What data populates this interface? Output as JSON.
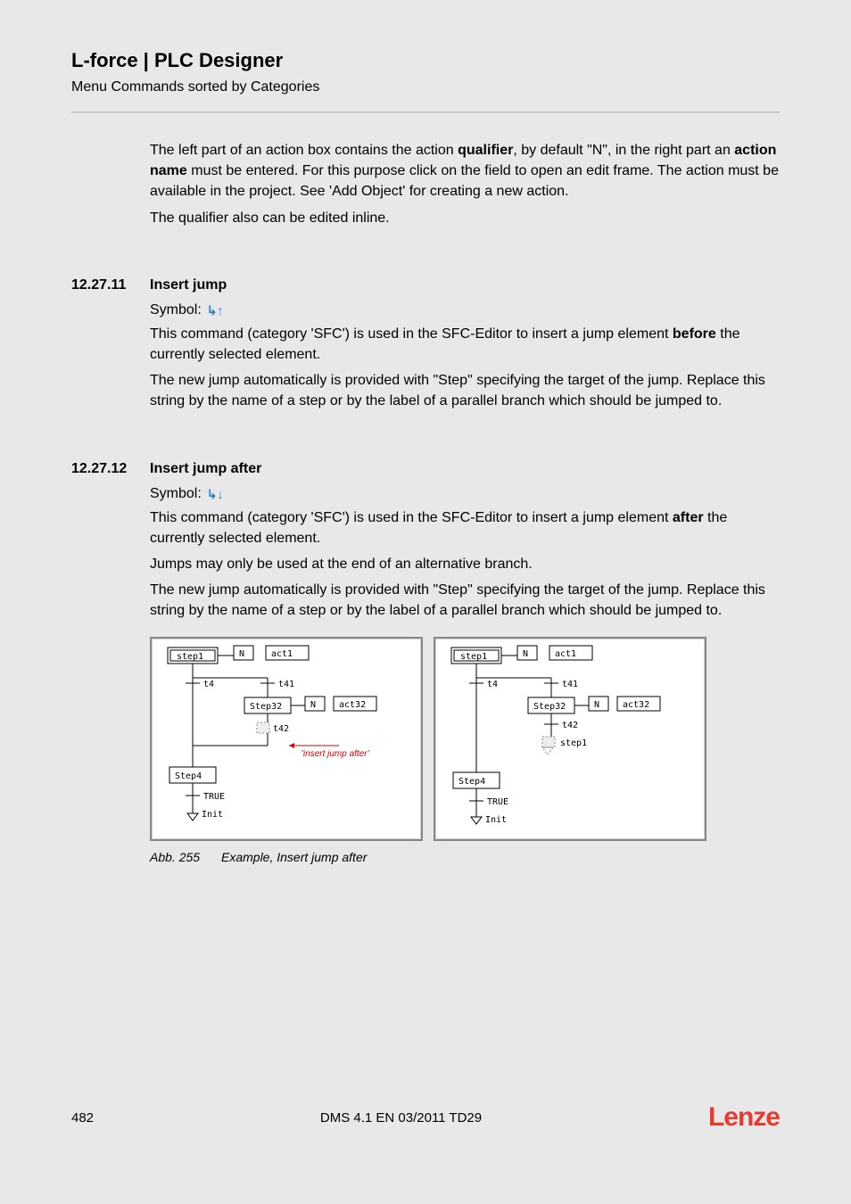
{
  "header": {
    "title": "L-force | PLC Designer",
    "subtitle": "Menu Commands sorted by Categories"
  },
  "intro": {
    "p1a": "The left part of an action box contains the action ",
    "p1b": "qualifier",
    "p1c": ", by default \"N\", in the right part an ",
    "p1d": "action name",
    "p1e": " must be entered.  For this purpose click on the field to open an edit frame. The action must be available in the project. See 'Add Object' for creating a new action.",
    "p2": "The qualifier also can be edited inline."
  },
  "sec1": {
    "num": "12.27.11",
    "title": "Insert jump",
    "symlabel": "Symbol:",
    "p1a": "This command (category 'SFC') is used in the SFC-Editor to insert a jump element ",
    "p1b": "before",
    "p1c": " the currently selected element.",
    "p2": "The new jump automatically is provided with \"Step\" specifying the target of the jump. Replace this string by the name of a step or by the label of a parallel branch which should be jumped to."
  },
  "sec2": {
    "num": "12.27.12",
    "title": "Insert jump after",
    "symlabel": "Symbol:",
    "p1a": "This command (category 'SFC') is used in the SFC-Editor to insert a jump element ",
    "p1b": "after",
    "p1c": " the currently selected element.",
    "p2": "Jumps may only be used at the end of an alternative branch.",
    "p3": "The new jump automatically is provided with \"Step\" specifying the target of the jump. Replace this string by the name of a step or by the label of a parallel branch which should be jumped to."
  },
  "figure": {
    "caption_num": "Abb. 255",
    "caption_text": "Example, Insert jump after",
    "left": {
      "step1": "step1",
      "t4": "t4",
      "t41": "t41",
      "step32": "Step32",
      "n1": "N",
      "act1": "act1",
      "n2": "N",
      "act32": "act32",
      "t42": "t42",
      "hint": "'insert jump after'",
      "step4": "Step4",
      "true": "TRUE",
      "init": "Init"
    },
    "right": {
      "step1": "step1",
      "t4": "t4",
      "t41": "t41",
      "step32": "Step32",
      "n1": "N",
      "act1": "act1",
      "n2": "N",
      "act32": "act32",
      "t42": "t42",
      "jstep1": "step1",
      "step4": "Step4",
      "true": "TRUE",
      "init": "Init"
    }
  },
  "footer": {
    "page": "482",
    "docid": "DMS 4.1 EN 03/2011 TD29",
    "brand": "Lenze"
  }
}
